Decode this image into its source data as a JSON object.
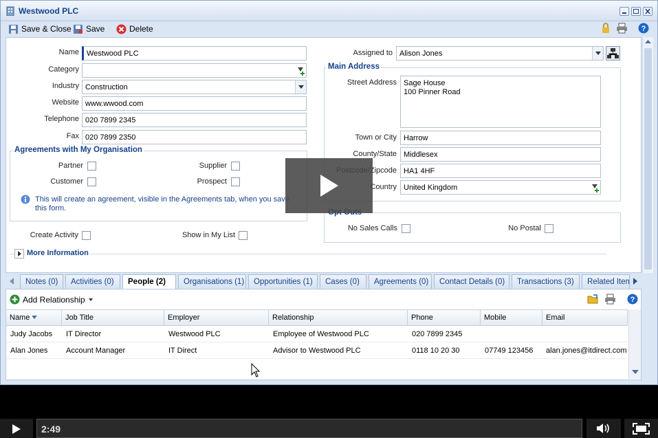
{
  "window": {
    "title": "Westwood PLC"
  },
  "toolbar": {
    "save_close": "Save & Close",
    "save": "Save",
    "delete": "Delete"
  },
  "form": {
    "name_label": "Name",
    "name_value": "Westwood PLC",
    "category_label": "Category",
    "category_value": "",
    "industry_label": "Industry",
    "industry_value": "Construction",
    "website_label": "Website",
    "website_value": "www.wwood.com",
    "telephone_label": "Telephone",
    "telephone_value": "020 7899 2345",
    "fax_label": "Fax",
    "fax_value": "020 7899 2350",
    "agreements_title": "Agreements with My Organisation",
    "partner_label": "Partner",
    "supplier_label": "Supplier",
    "customer_label": "Customer",
    "prospect_label": "Prospect",
    "agreement_info": "This will create an agreement, visible in the Agreements tab, when you save this form.",
    "create_activity_label": "Create Activity",
    "show_in_list_label": "Show in My List",
    "more_info": "More Information",
    "assigned_label": "Assigned to",
    "assigned_value": "Alison Jones",
    "main_address_title": "Main Address",
    "street_label": "Street Address",
    "street_line1": "Sage House",
    "street_line2": "100 Pinner Road",
    "town_label": "Town or City",
    "town_value": "Harrow",
    "county_label": "County/State",
    "county_value": "Middlesex",
    "postcode_label": "Postcode/Zipcode",
    "postcode_value": "HA1 4HF",
    "country_label": "Country",
    "country_value": "United Kingdom",
    "opt_outs_title": "Opt Outs",
    "no_sales_calls_label": "No Sales Calls",
    "no_postal_label": "No Postal"
  },
  "tabs": [
    "Notes (0)",
    "Activities (0)",
    "People (2)",
    "Organisations (1)",
    "Opportunities (1)",
    "Cases (0)",
    "Agreements (0)",
    "Contact Details (0)",
    "Transactions (3)",
    "Related Items"
  ],
  "relationships": {
    "add_label": "Add Relationship",
    "columns": [
      "Name",
      "Job Title",
      "Employer",
      "Relationship",
      "Phone",
      "Mobile",
      "Email"
    ],
    "rows": [
      [
        "Judy Jacobs",
        "IT Director",
        "Westwood PLC",
        "Employee of Westwood PLC",
        "020 7899 2345",
        "",
        ""
      ],
      [
        "Alan Jones",
        "Account Manager",
        "IT Direct",
        "Advisor to Westwood PLC",
        "0118 10 20 30",
        "07749 123456",
        "alan.jones@itdirect.com"
      ]
    ]
  },
  "player": {
    "time": "2:49"
  }
}
